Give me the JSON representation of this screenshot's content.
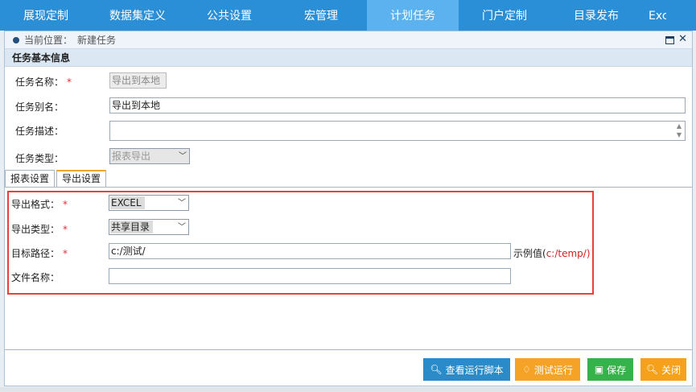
{
  "nav": {
    "items": [
      "展现定制",
      "数据集定义",
      "公共设置",
      "宏管理",
      "计划任务",
      "门户定制",
      "目录发布",
      "Exc"
    ],
    "active_index": 4
  },
  "titlebar": {
    "crumb_label": "当前位置：",
    "crumb_value": "新建任务"
  },
  "section": {
    "title": "任务基本信息"
  },
  "form": {
    "name_label": "任务名称：",
    "name_value": "导出到本地",
    "alias_label": "任务别名：",
    "alias_value": "导出到本地",
    "desc_label": "任务描述：",
    "desc_value": "",
    "type_label": "任务类型：",
    "type_value": "报表导出"
  },
  "tabs": [
    "报表设置",
    "导出设置"
  ],
  "export": {
    "format_label": "导出格式：",
    "format_value": "EXCEL",
    "target_type_label": "导出类型：",
    "target_type_value": "共享目录",
    "path_label": "目标路径：",
    "path_value": "c:/测试/",
    "path_hint": "示例值(",
    "path_hint_example": "c:/temp/",
    "path_hint_end": ")",
    "filename_label": "文件名称：",
    "filename_value": ""
  },
  "required_mark": "*",
  "buttons": {
    "view_script": "查看运行脚本",
    "test_run": "测试运行",
    "save": "保存",
    "close": "关闭"
  },
  "colors": {
    "nav_bg": "#2b8fd8",
    "nav_active": "#5cb2ee",
    "highlight": "#e8403a",
    "required": "#e0303a"
  }
}
